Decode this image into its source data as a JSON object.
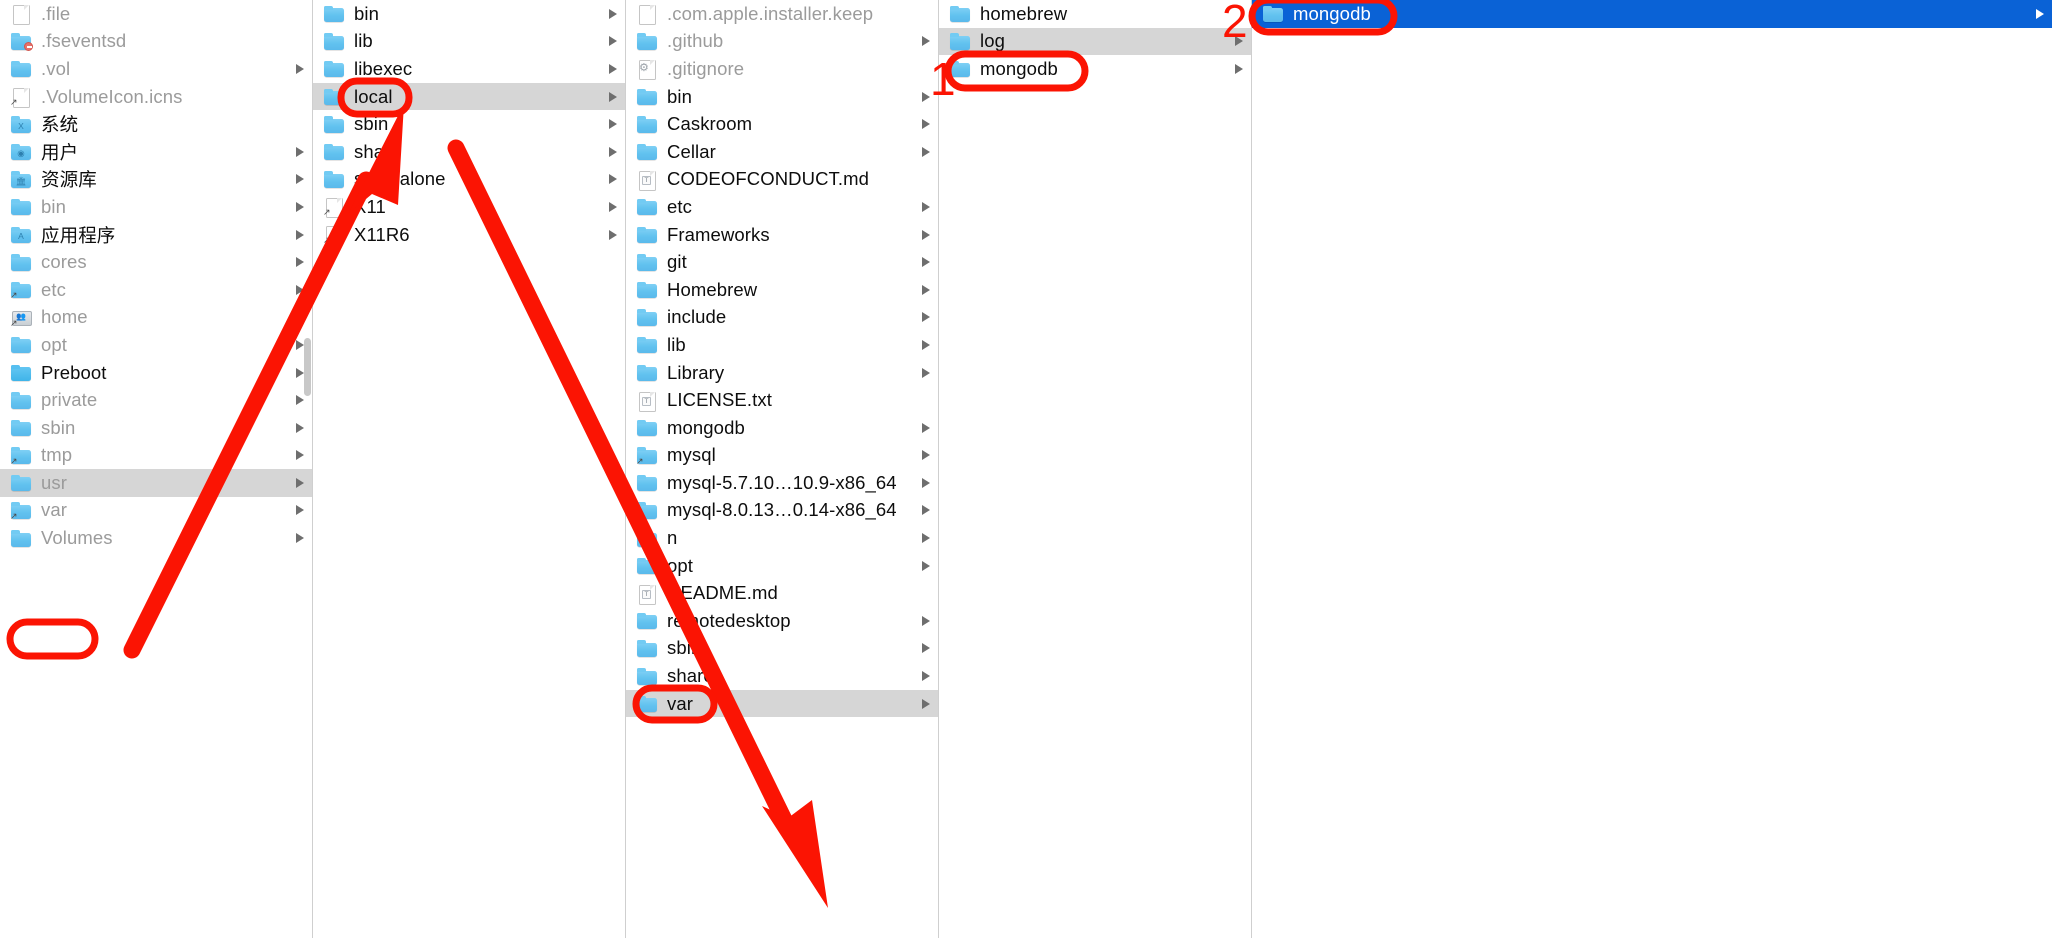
{
  "app": {
    "name": "Finder",
    "view": "column-view"
  },
  "colors": {
    "selection_active": "#0a62d6",
    "selection_inactive": "#d6d6d6",
    "annotation_red": "#fb1403",
    "folder_blue": "#62c2ef",
    "label_text": "#1d1d1f",
    "label_dim": "#9b9b9b"
  },
  "columns": [
    {
      "name": "column-root",
      "path_label": "/",
      "items": [
        {
          "label": ".file",
          "icon": "document-icon",
          "dim": true,
          "disclosure": false
        },
        {
          "label": ".fseventsd",
          "icon": "folder-restricted-icon",
          "dim": true,
          "disclosure": false
        },
        {
          "label": ".vol",
          "icon": "folder-icon",
          "dim": true,
          "disclosure": true
        },
        {
          "label": ".VolumeIcon.icns",
          "icon": "document-alias-icon",
          "dim": true,
          "disclosure": false
        },
        {
          "label": "系统",
          "icon": "folder-system-icon",
          "dim": false,
          "disclosure": false
        },
        {
          "label": "用户",
          "icon": "folder-users-icon",
          "dim": false,
          "disclosure": true
        },
        {
          "label": "资源库",
          "icon": "folder-library-icon",
          "dim": false,
          "disclosure": true
        },
        {
          "label": "bin",
          "icon": "folder-icon",
          "dim": true,
          "disclosure": true
        },
        {
          "label": "应用程序",
          "icon": "folder-applications-icon",
          "dim": false,
          "disclosure": true
        },
        {
          "label": "cores",
          "icon": "folder-icon",
          "dim": true,
          "disclosure": true
        },
        {
          "label": "etc",
          "icon": "folder-alias-icon",
          "dim": true,
          "disclosure": true
        },
        {
          "label": "home",
          "icon": "server-alias-icon",
          "dim": true,
          "disclosure": true
        },
        {
          "label": "opt",
          "icon": "folder-icon",
          "dim": true,
          "disclosure": true
        },
        {
          "label": "Preboot",
          "icon": "folder-dark-icon",
          "dim": false,
          "disclosure": true
        },
        {
          "label": "private",
          "icon": "folder-icon",
          "dim": true,
          "disclosure": true
        },
        {
          "label": "sbin",
          "icon": "folder-icon",
          "dim": true,
          "disclosure": true
        },
        {
          "label": "tmp",
          "icon": "folder-alias-icon",
          "dim": true,
          "disclosure": true
        },
        {
          "label": "usr",
          "icon": "folder-icon",
          "dim": true,
          "disclosure": true,
          "selected": "inactive"
        },
        {
          "label": "var",
          "icon": "folder-alias-icon",
          "dim": true,
          "disclosure": true
        },
        {
          "label": "Volumes",
          "icon": "folder-icon",
          "dim": true,
          "disclosure": true
        }
      ]
    },
    {
      "name": "column-usr",
      "path_label": "/usr",
      "items": [
        {
          "label": "bin",
          "icon": "folder-icon",
          "dim": false,
          "disclosure": true
        },
        {
          "label": "lib",
          "icon": "folder-icon",
          "dim": false,
          "disclosure": true
        },
        {
          "label": "libexec",
          "icon": "folder-icon",
          "dim": false,
          "disclosure": true
        },
        {
          "label": "local",
          "icon": "folder-icon",
          "dim": false,
          "disclosure": true,
          "selected": "inactive"
        },
        {
          "label": "sbin",
          "icon": "folder-icon",
          "dim": false,
          "disclosure": true
        },
        {
          "label": "share",
          "icon": "folder-icon",
          "dim": false,
          "disclosure": true
        },
        {
          "label": "standalone",
          "icon": "folder-icon",
          "dim": false,
          "disclosure": true
        },
        {
          "label": "X11",
          "icon": "document-alias-icon",
          "dim": false,
          "disclosure": true
        },
        {
          "label": "X11R6",
          "icon": "document-alias-icon",
          "dim": false,
          "disclosure": true
        }
      ]
    },
    {
      "name": "column-usr-local",
      "path_label": "/usr/local",
      "items": [
        {
          "label": ".com.apple.installer.keep",
          "icon": "document-icon",
          "dim": true,
          "disclosure": false
        },
        {
          "label": ".github",
          "icon": "folder-icon",
          "dim": true,
          "disclosure": true
        },
        {
          "label": ".gitignore",
          "icon": "gear-document-icon",
          "dim": true,
          "disclosure": false
        },
        {
          "label": "bin",
          "icon": "folder-icon",
          "dim": false,
          "disclosure": true
        },
        {
          "label": "Caskroom",
          "icon": "folder-icon",
          "dim": false,
          "disclosure": true
        },
        {
          "label": "Cellar",
          "icon": "folder-icon",
          "dim": false,
          "disclosure": true
        },
        {
          "label": "CODEOFCONDUCT.md",
          "icon": "text-document-icon",
          "dim": false,
          "disclosure": false
        },
        {
          "label": "etc",
          "icon": "folder-icon",
          "dim": false,
          "disclosure": true
        },
        {
          "label": "Frameworks",
          "icon": "folder-icon",
          "dim": false,
          "disclosure": true
        },
        {
          "label": "git",
          "icon": "folder-icon",
          "dim": false,
          "disclosure": true
        },
        {
          "label": "Homebrew",
          "icon": "folder-icon",
          "dim": false,
          "disclosure": true
        },
        {
          "label": "include",
          "icon": "folder-icon",
          "dim": false,
          "disclosure": true
        },
        {
          "label": "lib",
          "icon": "folder-icon",
          "dim": false,
          "disclosure": true
        },
        {
          "label": "Library",
          "icon": "folder-icon",
          "dim": false,
          "disclosure": true
        },
        {
          "label": "LICENSE.txt",
          "icon": "text-document-icon",
          "dim": false,
          "disclosure": false
        },
        {
          "label": "mongodb",
          "icon": "folder-icon",
          "dim": false,
          "disclosure": true
        },
        {
          "label": "mysql",
          "icon": "folder-alias-icon",
          "dim": false,
          "disclosure": true
        },
        {
          "label": "mysql-5.7.10…10.9-x86_64",
          "icon": "folder-icon",
          "dim": false,
          "disclosure": true
        },
        {
          "label": "mysql-8.0.13…0.14-x86_64",
          "icon": "folder-icon",
          "dim": false,
          "disclosure": true
        },
        {
          "label": "n",
          "icon": "folder-icon",
          "dim": false,
          "disclosure": true
        },
        {
          "label": "opt",
          "icon": "folder-icon",
          "dim": false,
          "disclosure": true
        },
        {
          "label": "README.md",
          "icon": "text-document-icon",
          "dim": false,
          "disclosure": false
        },
        {
          "label": "remotedesktop",
          "icon": "folder-icon",
          "dim": false,
          "disclosure": true
        },
        {
          "label": "sbin",
          "icon": "folder-icon",
          "dim": false,
          "disclosure": true
        },
        {
          "label": "share",
          "icon": "folder-icon",
          "dim": false,
          "disclosure": true
        },
        {
          "label": "var",
          "icon": "folder-icon",
          "dim": false,
          "disclosure": true,
          "selected": "inactive"
        }
      ]
    },
    {
      "name": "column-usr-local-var",
      "path_label": "/usr/local/var",
      "items": [
        {
          "label": "homebrew",
          "icon": "folder-icon",
          "dim": false,
          "disclosure": false
        },
        {
          "label": "log",
          "icon": "folder-icon",
          "dim": false,
          "disclosure": true,
          "selected": "inactive"
        },
        {
          "label": "mongodb",
          "icon": "folder-icon",
          "dim": false,
          "disclosure": true
        }
      ]
    },
    {
      "name": "column-usr-local-var-log",
      "path_label": "/usr/local/var/log",
      "items": [
        {
          "label": "mongodb",
          "icon": "folder-icon",
          "dim": false,
          "disclosure": true,
          "selected": "active"
        }
      ]
    }
  ],
  "annotations": {
    "numbers": [
      {
        "name": "annotation-number-1",
        "text": "1"
      },
      {
        "name": "annotation-number-2",
        "text": "2"
      }
    ],
    "highlight_targets": [
      "usr",
      "local",
      "var",
      "mongodb",
      "mongodb"
    ],
    "arrows": [
      {
        "name": "arrow-usr-to-local",
        "from": "usr",
        "to": "local"
      },
      {
        "name": "arrow-local-to-var",
        "from": "local",
        "to": "var"
      }
    ]
  }
}
